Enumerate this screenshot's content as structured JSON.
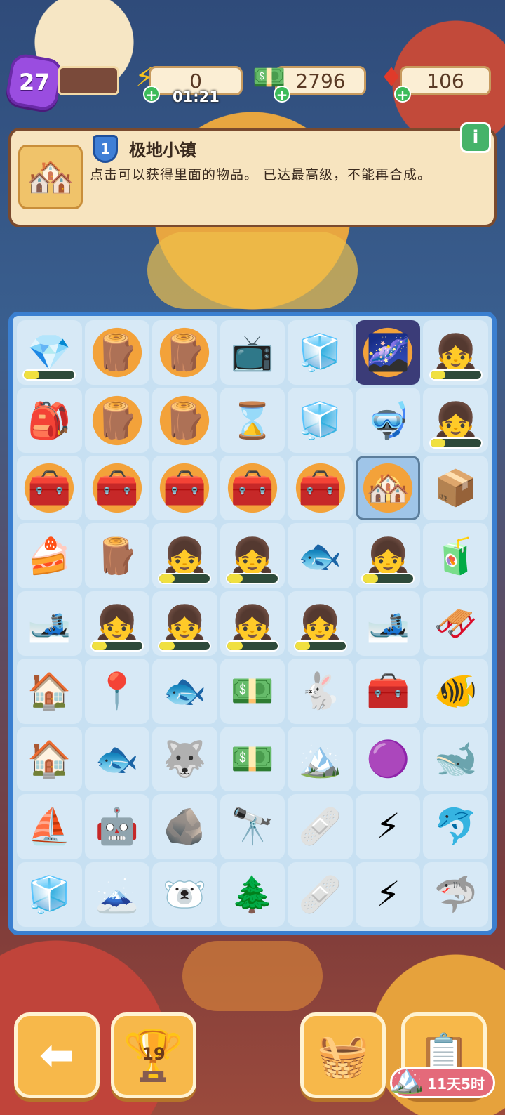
{
  "hud": {
    "level": "27",
    "energy": {
      "value": "0",
      "timer": "01:21",
      "icon": "lightning-icon"
    },
    "cash": {
      "value": "2796",
      "icon": "cash-stack-icon"
    },
    "gems": {
      "value": "106",
      "icon": "red-gem-icon"
    },
    "plus": "+"
  },
  "info": {
    "level": "1",
    "title": "极地小镇",
    "description": "点击可以获得里面的物品。 已达最高级，不能再合成。",
    "info_button": "i",
    "thumb_icon": "🏘️"
  },
  "board": {
    "rows": [
      [
        {
          "name": "ice-crystal-forge",
          "icon": "💎",
          "progress": 0.3
        },
        {
          "name": "energy-log-pile",
          "icon": "🪵",
          "energy": true
        },
        {
          "name": "energy-log-pile",
          "icon": "🪵",
          "energy": true
        },
        {
          "name": "retro-tv",
          "icon": "📺"
        },
        {
          "name": "ice-cube",
          "icon": "🧊"
        },
        {
          "name": "aurora-energy",
          "icon": "🌌",
          "energy": true,
          "dark": true
        },
        {
          "name": "explorer-girl",
          "icon": "👧",
          "progress": 0.3
        }
      ],
      [
        {
          "name": "green-backpack",
          "icon": "🎒"
        },
        {
          "name": "energy-log-pile",
          "icon": "🪵",
          "energy": true
        },
        {
          "name": "energy-log-pile",
          "icon": "🪵",
          "energy": true
        },
        {
          "name": "hourglass",
          "icon": "⌛"
        },
        {
          "name": "ice-shard",
          "icon": "🧊"
        },
        {
          "name": "snorkel-mask",
          "icon": "🤿"
        },
        {
          "name": "explorer-girl",
          "icon": "👧",
          "progress": 0.3
        }
      ],
      [
        {
          "name": "energy-ski-chest",
          "icon": "🧰",
          "energy": true
        },
        {
          "name": "energy-ski-chest",
          "icon": "🧰",
          "energy": true
        },
        {
          "name": "energy-ski-chest",
          "icon": "🧰",
          "energy": true
        },
        {
          "name": "energy-ski-chest",
          "icon": "🧰",
          "energy": true
        },
        {
          "name": "energy-ski-chest",
          "icon": "🧰",
          "energy": true
        },
        {
          "name": "polar-town",
          "icon": "🏘️",
          "energy": true,
          "selected": true
        },
        {
          "name": "treasure-chest",
          "icon": "📦"
        }
      ],
      [
        {
          "name": "snow-plate",
          "icon": "🍰"
        },
        {
          "name": "wood-log",
          "icon": "🪵"
        },
        {
          "name": "explorer-girl",
          "icon": "👧",
          "progress": 0.3
        },
        {
          "name": "explorer-girl",
          "icon": "👧",
          "progress": 0.3
        },
        {
          "name": "blue-fish",
          "icon": "🐟"
        },
        {
          "name": "explorer-girl",
          "icon": "👧",
          "progress": 0.3
        },
        {
          "name": "juice-bottle",
          "icon": "🧃"
        }
      ],
      [
        {
          "name": "skis",
          "icon": "🎿"
        },
        {
          "name": "explorer-girl",
          "icon": "👧",
          "progress": 0.3
        },
        {
          "name": "explorer-girl",
          "icon": "👧",
          "progress": 0.3
        },
        {
          "name": "explorer-girl",
          "icon": "👧",
          "progress": 0.3
        },
        {
          "name": "explorer-girl",
          "icon": "👧",
          "progress": 0.3
        },
        {
          "name": "ski-set",
          "icon": "🎿"
        },
        {
          "name": "husky-sled",
          "icon": "🛷"
        }
      ],
      [
        {
          "name": "snow-cabin",
          "icon": "🏠"
        },
        {
          "name": "map-tablet",
          "icon": "📍"
        },
        {
          "name": "blue-fish",
          "icon": "🐟"
        },
        {
          "name": "cash-stack",
          "icon": "💵"
        },
        {
          "name": "snow-bunny",
          "icon": "🐇"
        },
        {
          "name": "toolbox",
          "icon": "🧰"
        },
        {
          "name": "swordfish",
          "icon": "🐠"
        }
      ],
      [
        {
          "name": "gingerbread-hut",
          "icon": "🏠"
        },
        {
          "name": "small-fish",
          "icon": "🐟"
        },
        {
          "name": "husky",
          "icon": "🐺"
        },
        {
          "name": "cash-pile",
          "icon": "💵"
        },
        {
          "name": "snowy-hill",
          "icon": "🏔️"
        },
        {
          "name": "purple-gem",
          "icon": "🟣"
        },
        {
          "name": "manta-ray",
          "icon": "🐋"
        }
      ],
      [
        {
          "name": "ice-boat",
          "icon": "⛵"
        },
        {
          "name": "helper-robot",
          "icon": "🤖"
        },
        {
          "name": "rocky-snow",
          "icon": "🪨"
        },
        {
          "name": "binoculars",
          "icon": "🔭"
        },
        {
          "name": "first-aid-kit",
          "icon": "🩹"
        },
        {
          "name": "energy-orb-orange",
          "icon": "⚡"
        },
        {
          "name": "dolphin",
          "icon": "🐬"
        }
      ],
      [
        {
          "name": "ice-blocks",
          "icon": "🧊"
        },
        {
          "name": "ice-mountain",
          "icon": "🗻"
        },
        {
          "name": "polar-bear",
          "icon": "🐻‍❄️"
        },
        {
          "name": "frozen-tree",
          "icon": "🌲"
        },
        {
          "name": "first-aid-kit",
          "icon": "🩹"
        },
        {
          "name": "energy-orb-blue",
          "icon": "⚡"
        },
        {
          "name": "shark",
          "icon": "🦈"
        }
      ]
    ]
  },
  "bottom": {
    "back_icon": "arrow-left-icon",
    "trophy_count": "19",
    "basket_icon": "basket-icon",
    "clipboard_icon": "clipboard-star-icon",
    "event_timer": "11天5时"
  }
}
